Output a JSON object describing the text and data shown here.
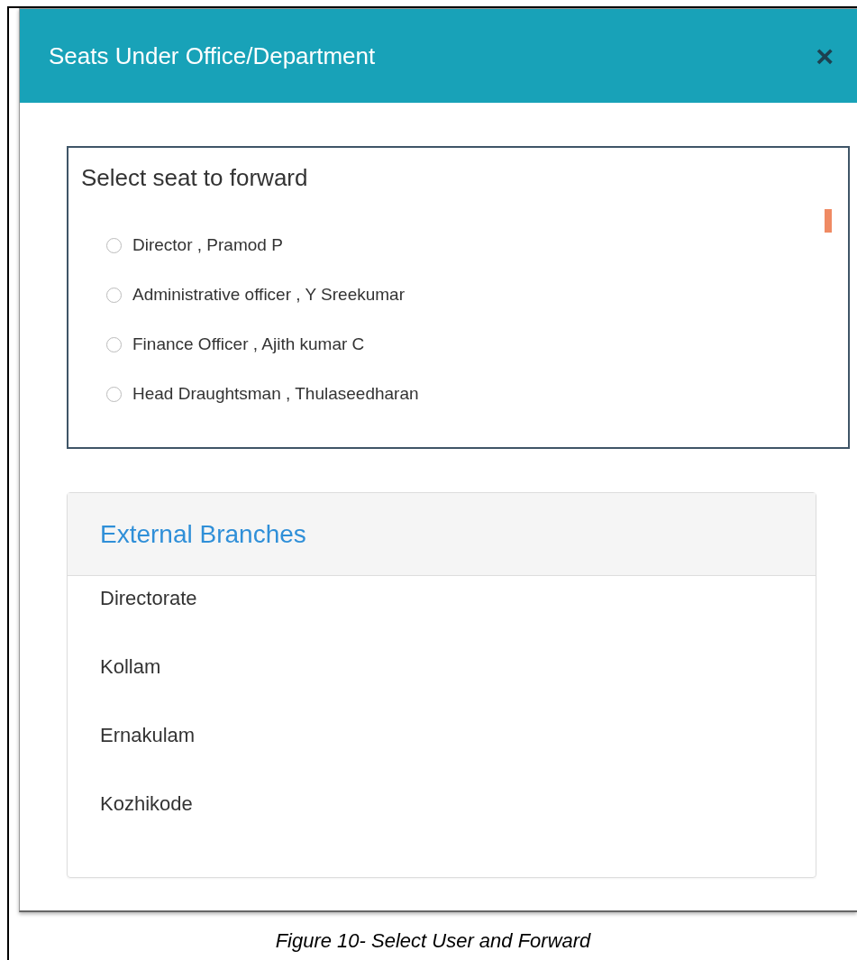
{
  "modal": {
    "title": "Seats Under Office/Department",
    "close": "×"
  },
  "seat_list": {
    "heading": "Select seat to forward",
    "seats": [
      {
        "label": "Director , Pramod P",
        "selected": false
      },
      {
        "label": "Administrative officer , Y Sreekumar",
        "selected": false
      },
      {
        "label": "Finance Officer , Ajith kumar C",
        "selected": false
      },
      {
        "label": "Head Draughtsman , Thulaseedharan",
        "selected": false
      }
    ]
  },
  "external_branches": {
    "title": "External Branches",
    "items": [
      "Directorate",
      "Kollam",
      "Ernakulam",
      "Kozhikode"
    ]
  },
  "caption": "Figure 10- Select User and Forward"
}
